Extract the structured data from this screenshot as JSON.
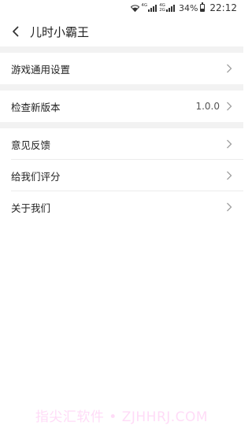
{
  "status_bar": {
    "network_top": "4G",
    "network_bottom": "2G",
    "network2_top": "4G",
    "battery_percent": "34%",
    "time": "22:12"
  },
  "header": {
    "title": "儿时小霸王"
  },
  "settings": {
    "game_settings_label": "游戏通用设置",
    "check_version_label": "检查新版本",
    "version_value": "1.0.0",
    "feedback_label": "意见反馈",
    "rate_label": "给我们评分",
    "about_label": "关于我们"
  },
  "watermark": "指尖汇软件 • ZJHHRJ.COM",
  "colors": {
    "background": "#ffffff",
    "separator": "#f2f2f2",
    "text": "#222222",
    "chevron": "#a0a0a0",
    "watermark": "#ff9be9"
  },
  "icons": {
    "back": "chevron-left-icon",
    "row_arrow": "chevron-right-icon",
    "wifi": "wifi-icon",
    "battery": "battery-icon"
  }
}
